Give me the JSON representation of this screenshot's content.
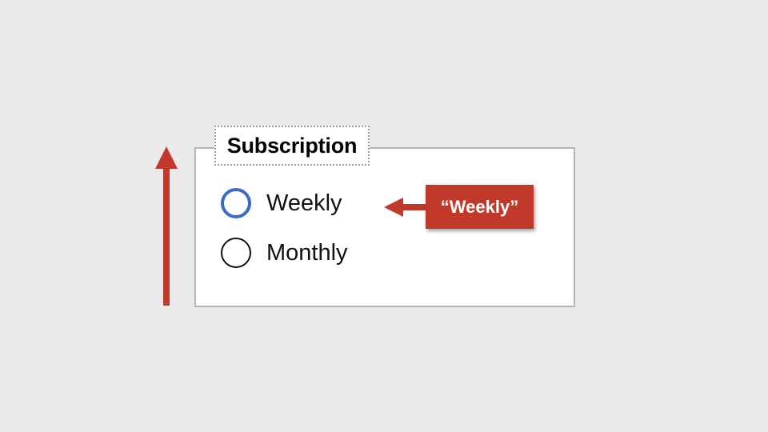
{
  "fieldset": {
    "legend": "Subscription"
  },
  "options": [
    {
      "label": "Weekly",
      "state": "focused"
    },
    {
      "label": "Monthly",
      "state": "unselected"
    }
  ],
  "annotation": {
    "callout_text": "“Weekly”"
  },
  "colors": {
    "background": "#ece9ea",
    "focus_ring": "#3a6cc4",
    "annotation_red": "#c0392b",
    "fieldset_border": "#b4b4b4"
  },
  "icons": {
    "scroll_direction": "arrow-up-icon",
    "callout_pointer": "arrow-left-icon"
  }
}
